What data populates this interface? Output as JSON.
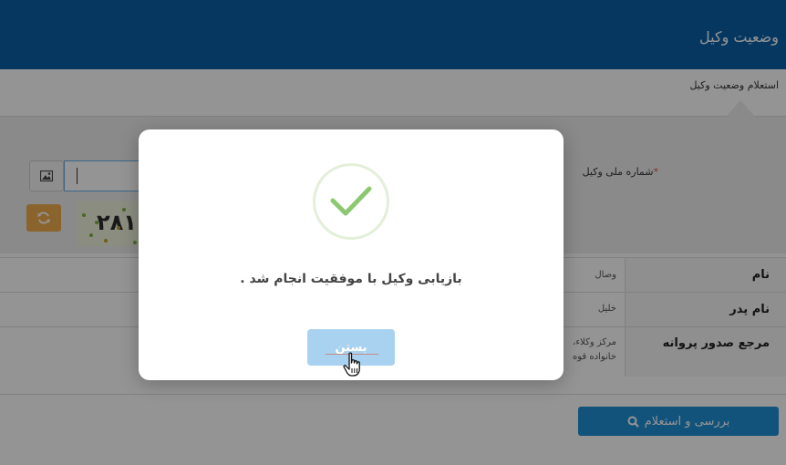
{
  "header": {
    "title": "وضعیت وکیل"
  },
  "breadcrumb": {
    "text": "استعلام وضعیت وکیل"
  },
  "form": {
    "national_id_label": "شماره ملی وکیل",
    "required_mark": "*",
    "national_id_value": "",
    "captcha_text": "۲۸۱"
  },
  "table": {
    "rows": [
      {
        "label": "نام",
        "value": "وصال"
      },
      {
        "label": "نام پدر",
        "value": "خلیل"
      },
      {
        "label": "مرجع صدور پروانه",
        "value_line1": "مرکز وکلاء،",
        "value_line2": "خانواده قوه"
      }
    ]
  },
  "actions": {
    "inquiry_label": "بررسی و استعلام"
  },
  "modal": {
    "message": "بازیابی وکیل با موفقیت انجام شد .",
    "close_label": "بستن",
    "icon": "check-icon"
  },
  "colors": {
    "header": "#0c5fa8",
    "success": "#8cc870",
    "primary_button": "#1f8fd6",
    "refresh_button": "#f0ad4e"
  }
}
